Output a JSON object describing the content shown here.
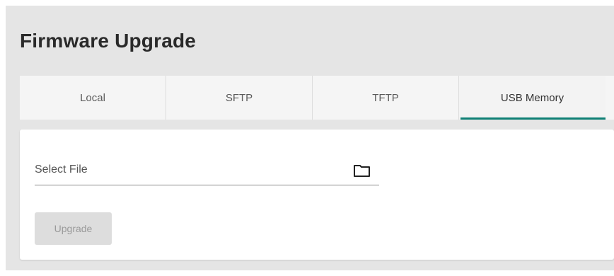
{
  "page": {
    "title": "Firmware Upgrade"
  },
  "tabs": [
    {
      "label": "Local",
      "active": false
    },
    {
      "label": "SFTP",
      "active": false
    },
    {
      "label": "TFTP",
      "active": false
    },
    {
      "label": "USB Memory",
      "active": true
    }
  ],
  "form": {
    "file_placeholder": "Select File",
    "file_icon": "folder-icon",
    "upgrade_label": "Upgrade",
    "upgrade_enabled": false
  },
  "colors": {
    "accent": "#0f8075",
    "page_background": "#e5e5e5",
    "card_background": "#ffffff",
    "disabled_button": "#dddddd"
  }
}
